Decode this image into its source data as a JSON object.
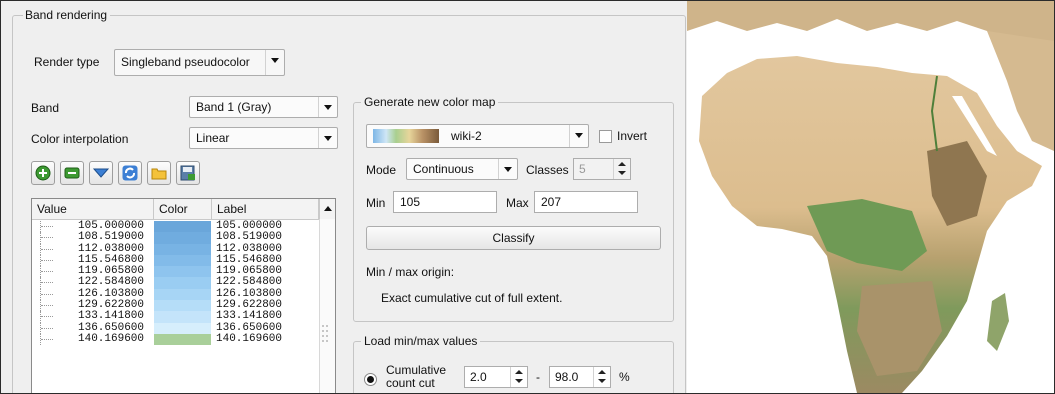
{
  "band_rendering": {
    "title": "Band rendering",
    "render_type_label": "Render type",
    "render_type_value": "Singleband pseudocolor",
    "band_label": "Band",
    "band_value": "Band 1 (Gray)",
    "interp_label": "Color interpolation",
    "interp_value": "Linear",
    "toolbar_icons": [
      "add-entry-icon",
      "remove-entry-icon",
      "load-from-band-icon",
      "refresh-icon",
      "open-folder-icon",
      "export-icon"
    ],
    "table": {
      "headers": [
        "Value",
        "Color",
        "Label"
      ],
      "rows": [
        {
          "value": "105.000000",
          "color": "#6aa6da",
          "label": "105.000000"
        },
        {
          "value": "108.519000",
          "color": "#70acdf",
          "label": "108.519000"
        },
        {
          "value": "112.038000",
          "color": "#78b3e4",
          "label": "112.038000"
        },
        {
          "value": "115.546800",
          "color": "#82bbe9",
          "label": "115.546800"
        },
        {
          "value": "119.065800",
          "color": "#8ec4ee",
          "label": "119.065800"
        },
        {
          "value": "122.584800",
          "color": "#9acdf2",
          "label": "122.584800"
        },
        {
          "value": "126.103800",
          "color": "#a7d5f5",
          "label": "126.103800"
        },
        {
          "value": "129.622800",
          "color": "#b5ddf8",
          "label": "129.622800"
        },
        {
          "value": "133.141800",
          "color": "#c4e4fa",
          "label": "133.141800"
        },
        {
          "value": "136.650600",
          "color": "#d6eefc",
          "label": "136.650600"
        },
        {
          "value": "140.169600",
          "color": "#a9cf9a",
          "label": "140.169600"
        }
      ]
    }
  },
  "color_map": {
    "title": "Generate new color map",
    "ramp_name": "wiki-2",
    "invert_label": "Invert",
    "mode_label": "Mode",
    "mode_value": "Continuous",
    "classes_label": "Classes",
    "classes_value": "5",
    "min_label": "Min",
    "min_value": "105",
    "max_label": "Max",
    "max_value": "207",
    "classify_label": "Classify",
    "origin_label": "Min / max origin:",
    "origin_value": "Exact cumulative cut of full extent."
  },
  "load_minmax": {
    "title": "Load min/max values",
    "option_label_line1": "Cumulative",
    "option_label_line2": "count cut",
    "low_value": "2.0",
    "dash": "-",
    "high_value": "98.0",
    "unit": "%"
  },
  "colors": {
    "panel_bg": "#efefef",
    "ocean": "#ffffff",
    "land_desert": "#dcbf93",
    "land_forest": "#6f9a55"
  }
}
